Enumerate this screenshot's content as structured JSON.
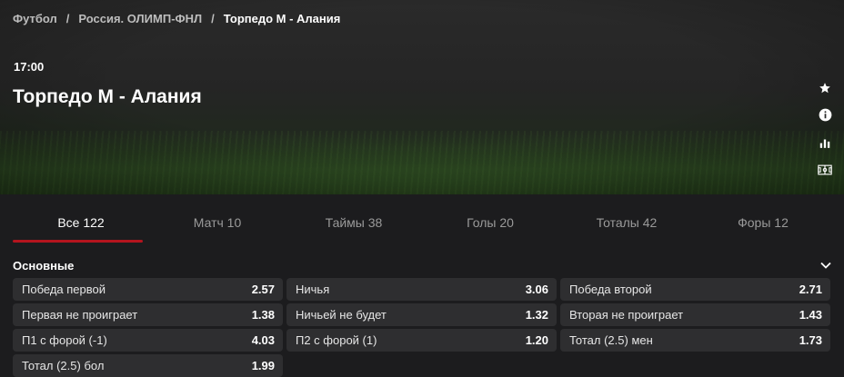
{
  "breadcrumb": [
    {
      "label": "Футбол"
    },
    {
      "label": "Россия. ОЛИМП-ФНЛ"
    },
    {
      "label": "Торпедо М - Алания"
    }
  ],
  "event": {
    "time": "17:00",
    "title": "Торпедо М - Алания"
  },
  "side_icons": [
    "star-icon",
    "info-icon",
    "stats-icon",
    "field-icon"
  ],
  "tabs": [
    {
      "label": "Все 122",
      "active": true
    },
    {
      "label": "Матч 10"
    },
    {
      "label": "Таймы 38"
    },
    {
      "label": "Голы 20"
    },
    {
      "label": "Тоталы 42"
    },
    {
      "label": "Форы 12"
    }
  ],
  "section": {
    "title": "Основные",
    "toggle_icon": "chevron-down-icon"
  },
  "odds": [
    {
      "name": "Победа первой",
      "value": "2.57"
    },
    {
      "name": "Ничья",
      "value": "3.06"
    },
    {
      "name": "Победа второй",
      "value": "2.71"
    },
    {
      "name": "Первая не проиграет",
      "value": "1.38"
    },
    {
      "name": "Ничьей не будет",
      "value": "1.32"
    },
    {
      "name": "Вторая не проиграет",
      "value": "1.43"
    },
    {
      "name": "П1 с форой (-1)",
      "value": "4.03"
    },
    {
      "name": "П2 с форой (1)",
      "value": "1.20"
    },
    {
      "name": "Тотал (2.5) мен",
      "value": "1.73"
    },
    {
      "name": "Тотал (2.5) бол",
      "value": "1.99"
    }
  ],
  "colors": {
    "background": "#1c1c1e",
    "odd_cell": "#2e2e30",
    "accent": "#b4141e",
    "muted_text": "#9a9a9a"
  }
}
